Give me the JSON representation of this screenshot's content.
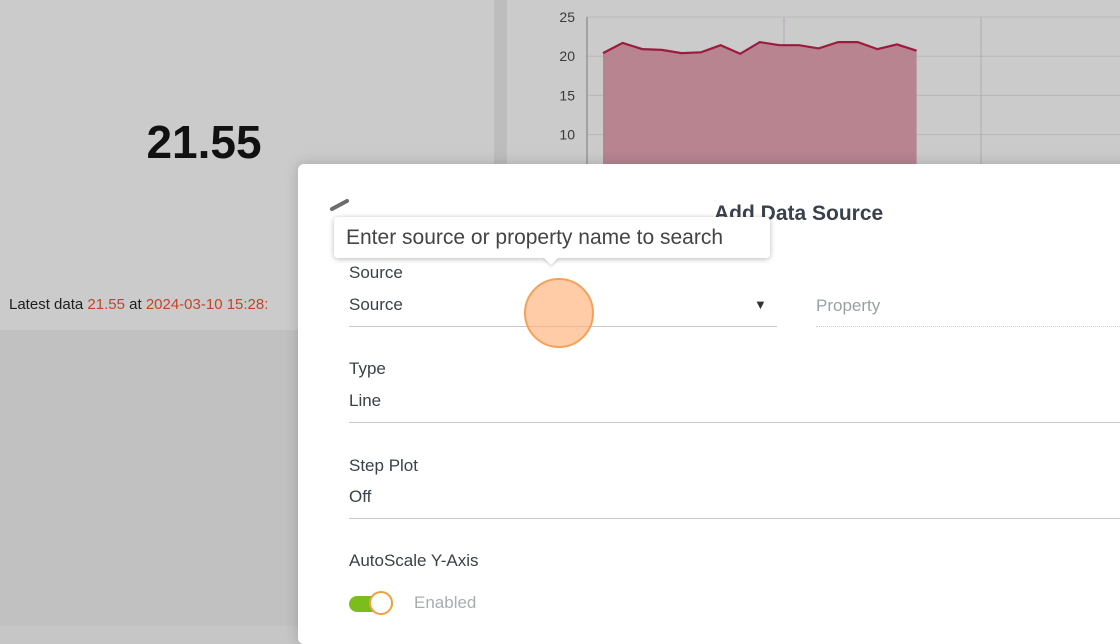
{
  "value_widget": {
    "value": "21.55",
    "latest_prefix": "Latest data",
    "latest_value": "21.55",
    "latest_at": "at",
    "latest_timestamp": "2024-03-10 15:28:"
  },
  "chart_data": {
    "type": "area",
    "title": "",
    "xlabel": "",
    "ylabel": "",
    "ylim": [
      0,
      25
    ],
    "yticks": [
      "25",
      "20",
      "15",
      "10"
    ],
    "grid": true,
    "series": [
      {
        "values": [
          20.4,
          21.7,
          20.9,
          20.8,
          20.4,
          20.5,
          21.4,
          20.3,
          21.8,
          21.4,
          21.4,
          21.0,
          21.8,
          21.8,
          20.9,
          21.5,
          20.7
        ],
        "color": "#9c1b3f",
        "fill": "#b5808c"
      }
    ]
  },
  "modal": {
    "title": "Add Data Source",
    "source": {
      "label": "Source",
      "value": "Source",
      "arrow": "▼"
    },
    "property": {
      "placeholder": "Property"
    },
    "type": {
      "label": "Type",
      "value": "Line"
    },
    "step_plot": {
      "label": "Step Plot",
      "value": "Off"
    },
    "autoscale": {
      "label": "AutoScale Y-Axis",
      "state": "Enabled"
    }
  },
  "tooltip": {
    "text": "Enter source or property name to search"
  },
  "colors": {
    "accent_orange": "#f5a15a",
    "toggle_green": "#7cbd1d",
    "highlight_text": "#c0462a"
  }
}
